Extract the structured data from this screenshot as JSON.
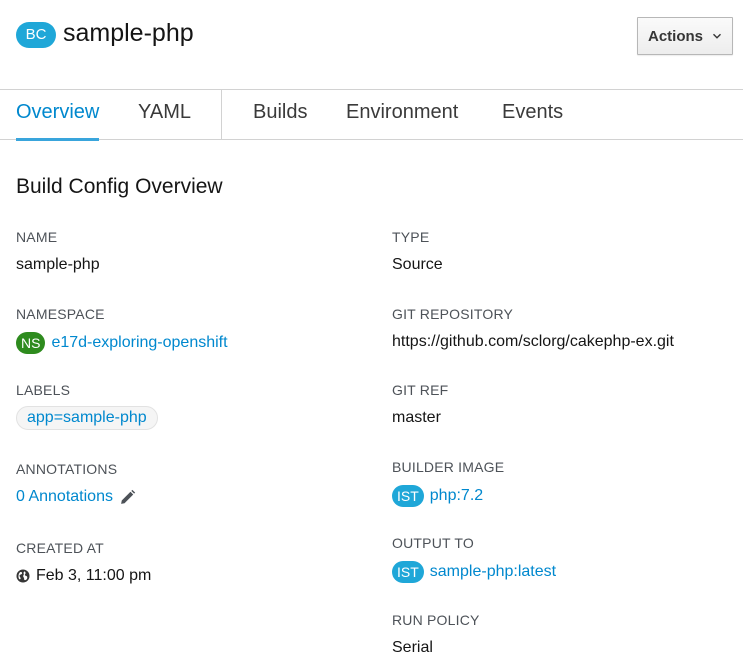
{
  "header": {
    "badge": "BC",
    "title": "sample-php",
    "actions_label": "Actions"
  },
  "tabs": [
    {
      "label": "Overview",
      "active": true
    },
    {
      "label": "YAML"
    },
    {
      "label": "Builds"
    },
    {
      "label": "Environment"
    },
    {
      "label": "Events"
    }
  ],
  "overview": {
    "section_title": "Build Config Overview",
    "name": {
      "label": "NAME",
      "value": "sample-php"
    },
    "namespace": {
      "label": "NAMESPACE",
      "badge": "NS",
      "value": "e17d-exploring-openshift"
    },
    "labels": {
      "label": "LABELS",
      "chips": [
        "app=sample-php"
      ]
    },
    "annotations": {
      "label": "ANNOTATIONS",
      "value": "0 Annotations"
    },
    "created_at": {
      "label": "CREATED AT",
      "value": "Feb 3, 11:00 pm"
    },
    "type": {
      "label": "TYPE",
      "value": "Source"
    },
    "git_repository": {
      "label": "GIT REPOSITORY",
      "value": "https://github.com/sclorg/cakephp-ex.git"
    },
    "git_ref": {
      "label": "GIT REF",
      "value": "master"
    },
    "builder_image": {
      "label": "BUILDER IMAGE",
      "badge": "IST",
      "value": "php:7.2"
    },
    "output_to": {
      "label": "OUTPUT TO",
      "badge": "IST",
      "value": "sample-php:latest"
    },
    "run_policy": {
      "label": "RUN POLICY",
      "value": "Serial"
    }
  },
  "icons": {
    "actions_chevron": "chevron-down-icon",
    "annotations_edit": "pencil-icon",
    "created_at": "globe-icon"
  },
  "colors": {
    "accent": "#0088ce",
    "bc_badge": "#1fa7d8",
    "ns_badge": "#2e8b1e",
    "ist_badge": "#1fa7d8"
  }
}
